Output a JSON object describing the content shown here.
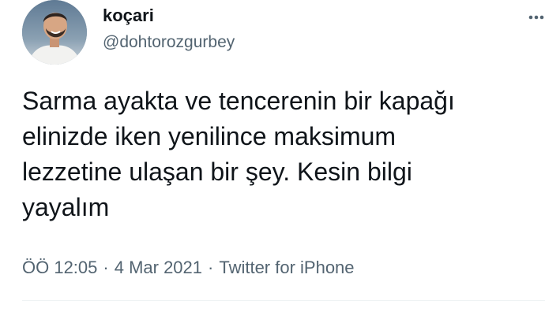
{
  "author": {
    "display_name": "koçari",
    "handle": "@dohtorozgurbey"
  },
  "tweet": {
    "text": "Sarma ayakta ve tencerenin bir kapağı\nelinizde iken yenilince maksimum\nlezzetine ulaşan bir şey. Kesin bilgi\nyayalım"
  },
  "meta": {
    "time": "ÖÖ 12:05",
    "separator": "·",
    "date": "4 Mar 2021",
    "source": "Twitter for iPhone"
  },
  "icons": {
    "avatar": "profile-photo",
    "more": "more-dots-icon"
  },
  "colors": {
    "text": "#0f1419",
    "secondary": "#536471",
    "divider": "#eff3f4"
  }
}
